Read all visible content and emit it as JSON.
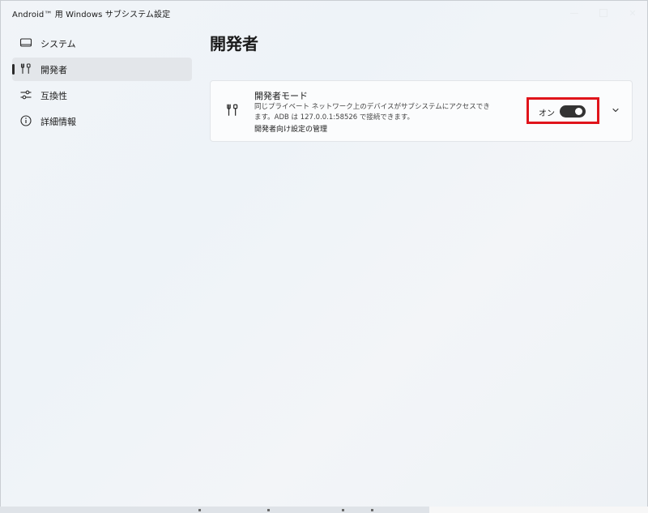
{
  "window": {
    "title": "Android™ 用 Windows サブシステム設定",
    "close_glyph": "✕"
  },
  "sidebar": {
    "items": [
      {
        "label": "システム",
        "icon": "monitor-icon",
        "selected": false
      },
      {
        "label": "開発者",
        "icon": "developer-tools-icon",
        "selected": true
      },
      {
        "label": "互換性",
        "icon": "sliders-icon",
        "selected": false
      },
      {
        "label": "詳細情報",
        "icon": "info-icon",
        "selected": false
      }
    ]
  },
  "main": {
    "title": "開発者",
    "developer_mode": {
      "title": "開発者モード",
      "description": "同じプライベート ネットワーク上のデバイスがサブシステムにアクセスできます。ADB は 127.0.0.1:58526 で接続できます。",
      "link": "開発者向け設定の管理",
      "toggle_label": "オン",
      "toggle_on": true,
      "icon": "developer-tools-icon",
      "expand_icon": "chevron-down-icon"
    }
  },
  "colors": {
    "highlight_border": "#e0141b",
    "toggle_on": "#333333",
    "selected_nav": "#e3e6ea"
  }
}
